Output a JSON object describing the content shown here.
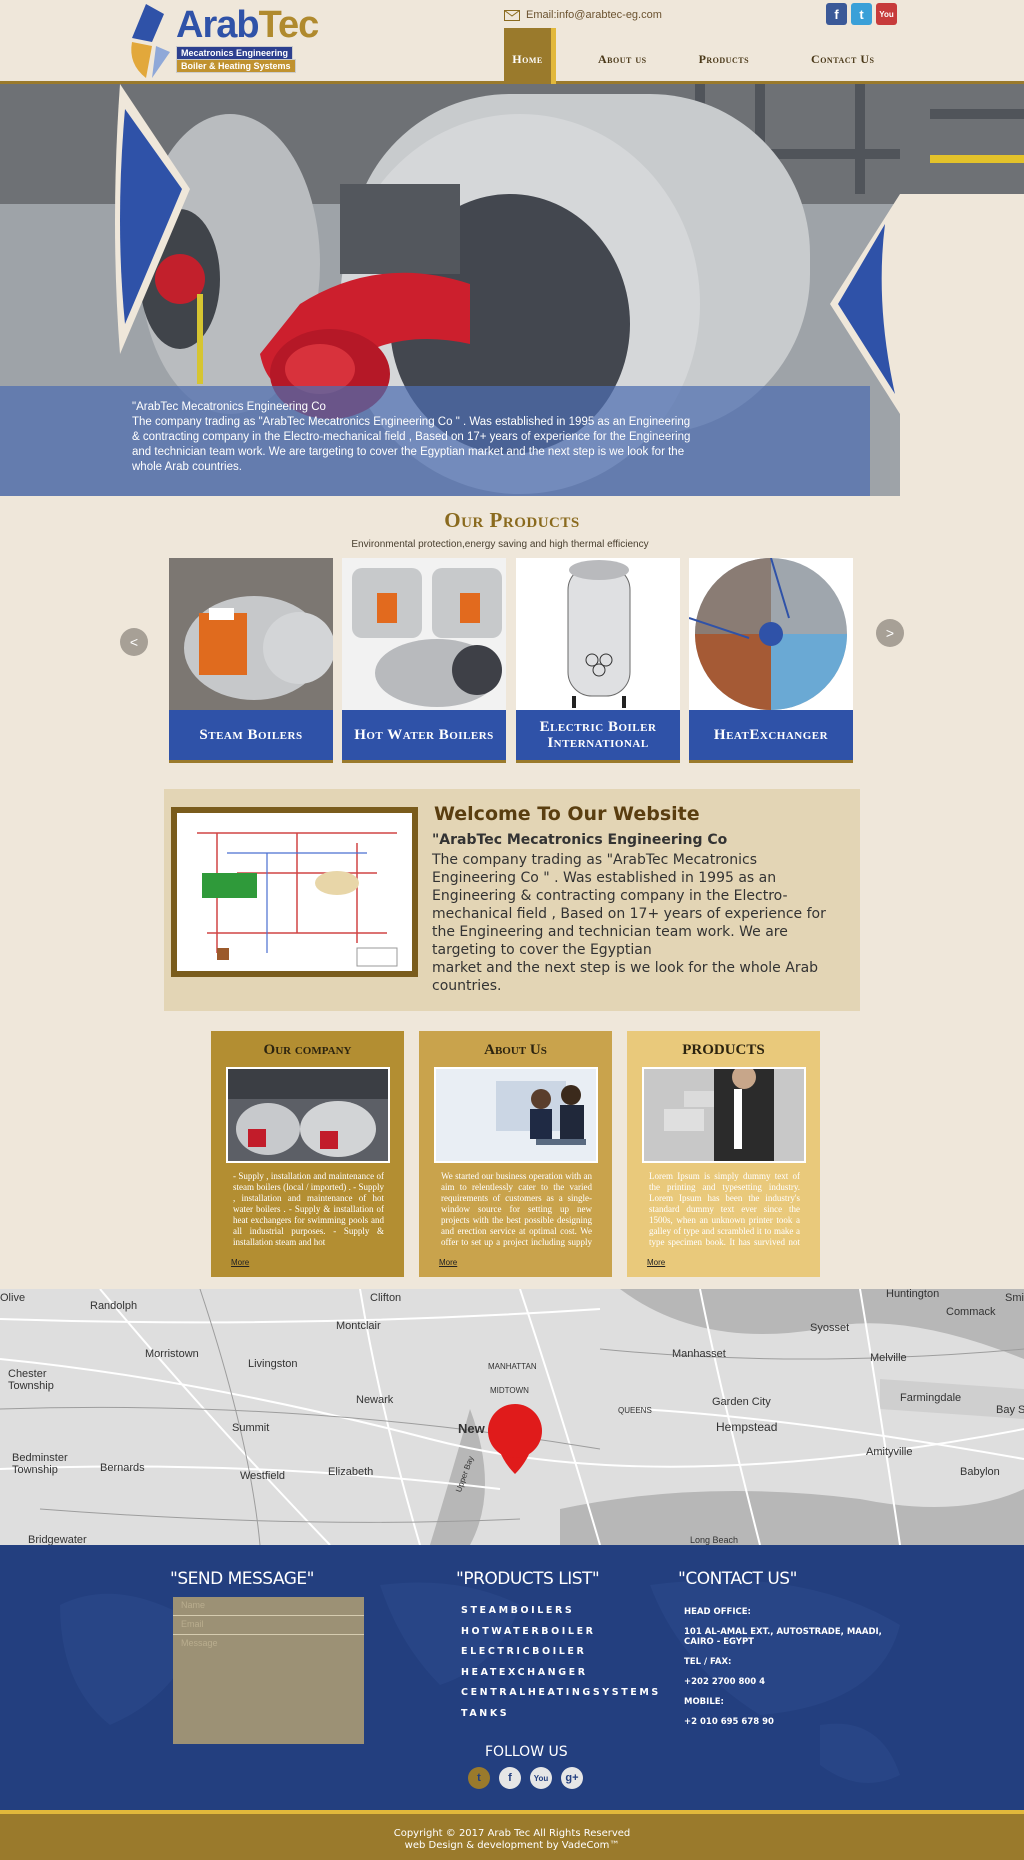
{
  "header": {
    "logo_word_a": "Arab",
    "logo_word_b": "Tec",
    "logo_line1": "Mecatronics Engineering",
    "logo_line2": "Boiler & Heating Systems",
    "email": "Email:info@arabtec-eg.com",
    "social": [
      {
        "letter": "f",
        "color": "#3b5998"
      },
      {
        "letter": "t",
        "color": "#3aa0d8"
      },
      {
        "letter": "You",
        "color": "#c73b3b"
      }
    ],
    "nav": [
      "Home",
      "About us",
      "Products",
      "Contact Us"
    ]
  },
  "hero": {
    "line1": "\"ArabTec Mecatronics Engineering Co",
    "body": "The company trading as \"ArabTec Mecatronics Engineering Co \" . Was established in 1995 as an Engineering & contracting company in the Electro-mechanical field , Based on 17+ years of experience for the Engineering and technician team work. We are targeting to cover the Egyptian market and the next step is we look for the whole Arab countries."
  },
  "products": {
    "title": "Our Products",
    "subtitle": "Environmental protection,energy saving and high thermal efficiency",
    "prev": "<",
    "next": ">",
    "items": [
      "Steam Boilers",
      "Hot Water Boilers",
      "Electric Boiler International",
      "HeatExchanger"
    ]
  },
  "welcome": {
    "title": "Welcome To Our Website",
    "subtitle": "\"ArabTec Mecatronics Engineering Co",
    "body1": "The company trading as \"ArabTec Mecatronics Engineering Co \" . Was established in 1995 as an Engineering & contracting company in the Electro-mechanical field , Based on 17+ years of experience for the Engineering and technician team work. We are targeting to cover the Egyptian",
    "body2": "market and the next step is we look for the whole Arab countries."
  },
  "cards": [
    {
      "title": "Our company",
      "color": "#b38e32",
      "more": "More",
      "text": "- Supply , installation and maintenance of steam boilers (local / imported) . - Supply , installation and maintenance of hot water boilers . - Supply & installation of heat exchangers for swimming pools and all industrial purposes. - Supply & installation steam and hot"
    },
    {
      "title": "About Us",
      "color": "#c9a34c",
      "more": "More",
      "text": "We started our business operation with an aim to relentlessly cater to the varied requirements of customers as a single-window source for setting up new projects with the best possible designing and erection service at optimal cost. We offer to set up a project including supply & installation"
    },
    {
      "title": "PRODUCTS",
      "color": "#e9c97b",
      "more": "More",
      "text": "Lorem Ipsum is simply dummy text of the printing and typesetting industry. Lorem Ipsum has been the industry's standard dummy text ever since the 1500s, when an unknown printer took a galley of type and scrambled it to make a type specimen book. It has survived not only five centuries, but also the leap"
    }
  ],
  "map": {
    "places": [
      "Olive",
      "Randolph",
      "Clifton",
      "Huntington",
      "Commack",
      "Smi",
      "Montclair",
      "Syosset",
      "Morristown",
      "Livingston",
      "Manhasset",
      "Melville",
      "Chester Township",
      "Newark",
      "MANHATTAN",
      "Garden City",
      "Farmingdale",
      "Summit",
      "New",
      "Hempstead",
      "Bay Shore",
      "Amityville",
      "Bedminster Township",
      "Bernards",
      "Westfield",
      "Elizabeth",
      "Babylon",
      "Bridgewater",
      "Long Beach",
      "QUEENS",
      "MIDTOWN",
      "Upper Bay"
    ]
  },
  "footer": {
    "send_title": "\"SEND MESSAGE\"",
    "name_ph": "Name",
    "email_ph": "Email",
    "msg_ph": "Message",
    "products_title": "\"PRODUCTS LIST\"",
    "products": [
      "STEAMBOILERS",
      "HOTWATERBOILER",
      "ELECTRICBOILER",
      "HEATEXCHANGER",
      "CENTRALHEATINGSYSTEMS",
      "TANKS"
    ],
    "contact_title": "\"CONTACT US\"",
    "head_office_label": "HEAD OFFICE:",
    "address": "101 AL-AMAL EXT., AUTOSTRADE, MAADI, CAIRO - EGYPT",
    "tel_label": "TEL / FAX:",
    "tel": "+202 2700 800 4",
    "mobile_label": "MOBILE:",
    "mobile": "+2 010 695 678 90",
    "follow": "FOLLOW US",
    "social": [
      "t",
      "f",
      "You",
      "g+"
    ],
    "copyright": "Copyright © 2017 Arab Tec All Rights Reserved",
    "credit": "web Design & development by VadeCom™"
  }
}
